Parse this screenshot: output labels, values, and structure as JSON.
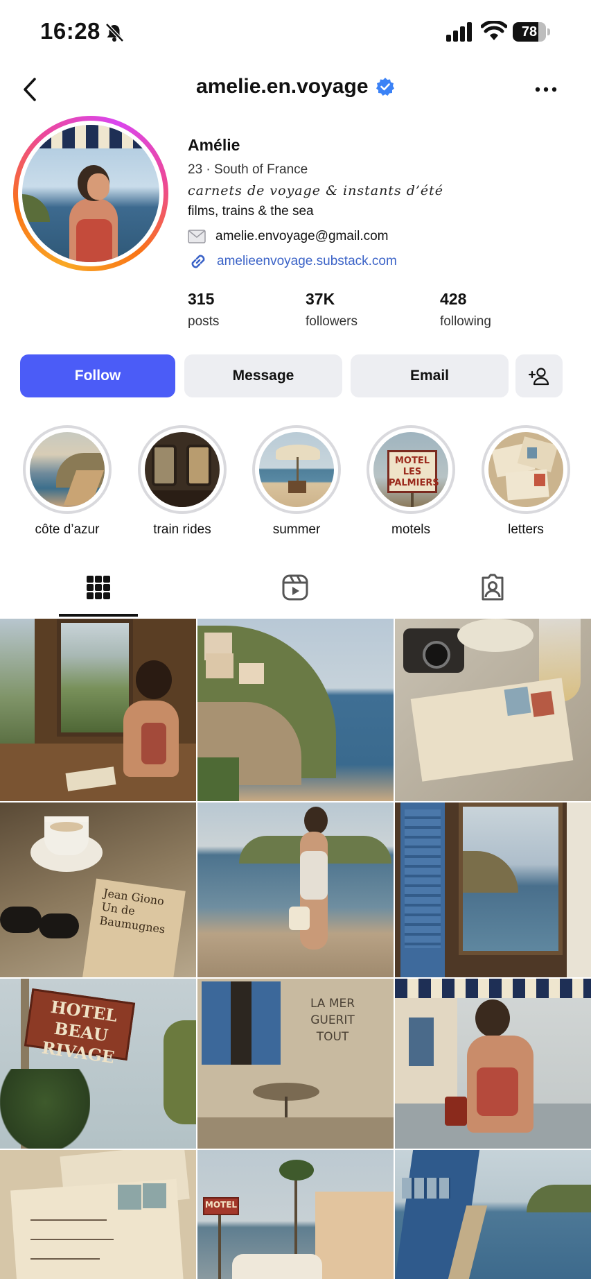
{
  "status_bar": {
    "time": "16:28",
    "battery": "78",
    "battery_level": 0.78
  },
  "header": {
    "username": "amelie.en.voyage"
  },
  "profile": {
    "name": "Amélie",
    "meta": "23 · South of France",
    "tagline": "carnets de voyage & instants d’été",
    "line": "films, trains & the sea",
    "email": "amelie.envoyage@gmail.com",
    "link": "amelieenvoyage.substack.com"
  },
  "stats": [
    {
      "value": "315",
      "label": "posts"
    },
    {
      "value": "37K",
      "label": "followers"
    },
    {
      "value": "428",
      "label": "following"
    }
  ],
  "actions": {
    "follow": "Follow",
    "message": "Message",
    "email": "Email"
  },
  "highlights": [
    {
      "label": "côte d’azur"
    },
    {
      "label": "train rides"
    },
    {
      "label": "summer"
    },
    {
      "label": "motels"
    },
    {
      "label": "letters"
    }
  ],
  "tabs": {
    "active": "grid"
  },
  "grid": {
    "post_texts": {
      "book": "Jean Giono Un de Baumugnes",
      "hotel_sign": "HOTEL BEAU RIVAGE",
      "wall_sign": "LA MER GUERIT TOUT",
      "motel_sign": "MOTEL",
      "highlight_motel": "MOTEL LES PALMIERS"
    }
  },
  "colors": {
    "accent": "#4b5cf7",
    "link": "#3a62c7",
    "verified": "#3b82f6",
    "button_bg": "#edeef2"
  }
}
